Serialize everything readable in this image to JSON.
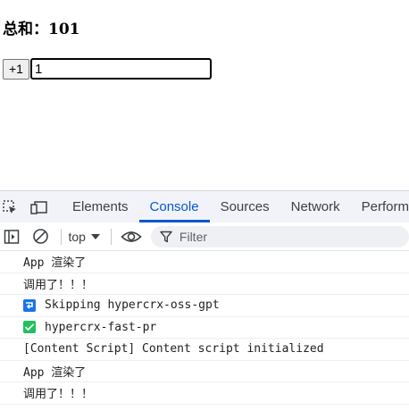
{
  "app": {
    "sum_label": "总和：101",
    "increment_label": "+1",
    "input_value": "1"
  },
  "devtools": {
    "tabs": [
      {
        "label": "Elements",
        "active": false
      },
      {
        "label": "Console",
        "active": true
      },
      {
        "label": "Sources",
        "active": false
      },
      {
        "label": "Network",
        "active": false
      },
      {
        "label": "Perform",
        "active": false
      }
    ],
    "toolbar": {
      "context": "top",
      "filter_placeholder": "Filter"
    },
    "messages": [
      {
        "text": "App 渲染了",
        "icon": null
      },
      {
        "text": "调用了！！！",
        "icon": null
      },
      {
        "text": "Skipping hypercrx-oss-gpt",
        "icon": "skip-icon"
      },
      {
        "text": "hypercrx-fast-pr",
        "icon": "check-icon"
      },
      {
        "text": "[Content Script] Content script initialized",
        "icon": null
      },
      {
        "text": "App 渲染了",
        "icon": null
      },
      {
        "text": "调用了！！！",
        "icon": null
      }
    ],
    "colors": {
      "accent": "#0b57d0",
      "skip_badge": "#1a73e8",
      "check_badge": "#1e8e3e"
    }
  }
}
